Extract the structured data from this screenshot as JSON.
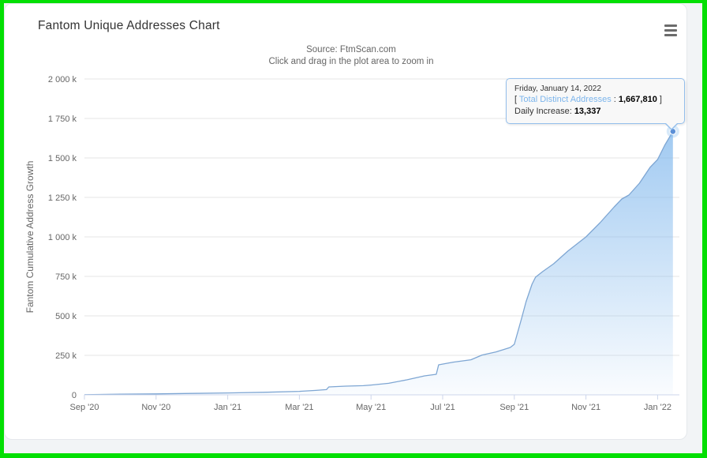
{
  "page": {
    "frame_color": "#03df03",
    "card_background": "#ffffff",
    "page_background": "#f2f4f6"
  },
  "header": {
    "title": "Fantom Unique Addresses Chart",
    "menu_icon": "hamburger-context-menu"
  },
  "chart_data": {
    "type": "area",
    "title": "Fantom Unique Addresses Chart",
    "subtitle_line1": "Source: FtmScan.com",
    "subtitle_line2": "Click and drag in the plot area to zoom in",
    "ylabel": "Fantom Cumulative Address Growth",
    "xlabel": "",
    "ylim": [
      0,
      2000000
    ],
    "grid": "horizontal",
    "legend": "none",
    "colors": {
      "area": "#7cb5ec",
      "line": "#7ea6d3",
      "marker": "#5b8fd6",
      "grid": "#e6e6e6",
      "axis": "#ccd6eb",
      "tooltip_border": "#94bfec"
    },
    "y_ticks": [
      {
        "value": 0,
        "label": "0"
      },
      {
        "value": 250,
        "label": "250 k"
      },
      {
        "value": 500,
        "label": "500 k"
      },
      {
        "value": 750,
        "label": "750 k"
      },
      {
        "value": 1000,
        "label": "1 000 k"
      },
      {
        "value": 1250,
        "label": "1 250 k"
      },
      {
        "value": 1500,
        "label": "1 500 k"
      },
      {
        "value": 1750,
        "label": "1 750 k"
      },
      {
        "value": 2000,
        "label": "2 000 k"
      }
    ],
    "x_ticks": [
      {
        "date": "2020-09-01",
        "label": "Sep '20"
      },
      {
        "date": "2020-11-01",
        "label": "Nov '20"
      },
      {
        "date": "2021-01-01",
        "label": "Jan '21"
      },
      {
        "date": "2021-03-01",
        "label": "Mar '21"
      },
      {
        "date": "2021-05-01",
        "label": "May '21"
      },
      {
        "date": "2021-07-01",
        "label": "Jul '21"
      },
      {
        "date": "2021-09-01",
        "label": "Sep '21"
      },
      {
        "date": "2021-11-01",
        "label": "Nov '21"
      },
      {
        "date": "2022-01-01",
        "label": "Jan '22"
      }
    ],
    "series": [
      {
        "name": "Total Distinct Addresses",
        "unit": "addresses (values in thousands)",
        "points": [
          [
            "2020-09-01",
            1
          ],
          [
            "2020-10-01",
            4
          ],
          [
            "2020-11-01",
            6
          ],
          [
            "2020-12-01",
            9
          ],
          [
            "2021-01-01",
            12
          ],
          [
            "2021-02-01",
            16
          ],
          [
            "2021-03-01",
            22
          ],
          [
            "2021-03-15",
            28
          ],
          [
            "2021-03-24",
            33
          ],
          [
            "2021-03-26",
            50
          ],
          [
            "2021-04-10",
            55
          ],
          [
            "2021-04-25",
            58
          ],
          [
            "2021-05-01",
            62
          ],
          [
            "2021-05-16",
            73
          ],
          [
            "2021-06-01",
            95
          ],
          [
            "2021-06-16",
            120
          ],
          [
            "2021-06-26",
            130
          ],
          [
            "2021-06-28",
            190
          ],
          [
            "2021-07-10",
            207
          ],
          [
            "2021-07-25",
            222
          ],
          [
            "2021-08-04",
            252
          ],
          [
            "2021-08-16",
            272
          ],
          [
            "2021-08-28",
            300
          ],
          [
            "2021-09-01",
            320
          ],
          [
            "2021-09-04",
            400
          ],
          [
            "2021-09-07",
            480
          ],
          [
            "2021-09-11",
            590
          ],
          [
            "2021-09-16",
            700
          ],
          [
            "2021-09-19",
            745
          ],
          [
            "2021-09-25",
            780
          ],
          [
            "2021-10-04",
            830
          ],
          [
            "2021-10-16",
            910
          ],
          [
            "2021-11-01",
            1000
          ],
          [
            "2021-11-13",
            1090
          ],
          [
            "2021-11-25",
            1190
          ],
          [
            "2021-12-01",
            1240
          ],
          [
            "2021-12-07",
            1265
          ],
          [
            "2021-12-16",
            1340
          ],
          [
            "2021-12-25",
            1440
          ],
          [
            "2022-01-01",
            1490
          ],
          [
            "2022-01-07",
            1580
          ],
          [
            "2022-01-14",
            1667.81
          ]
        ]
      }
    ],
    "highlight_point": {
      "date": "2022-01-14",
      "value": 1667810,
      "value_k": 1667.81,
      "daily_increase": 13337
    }
  },
  "tooltip": {
    "date": "Friday, January 14, 2022",
    "bracket_open": "[ ",
    "series_name": "Total Distinct Addresses",
    "separator": " : ",
    "total_value": "1,667,810",
    "bracket_close": " ]",
    "daily_label": "Daily Increase: ",
    "daily_value": "13,337"
  }
}
